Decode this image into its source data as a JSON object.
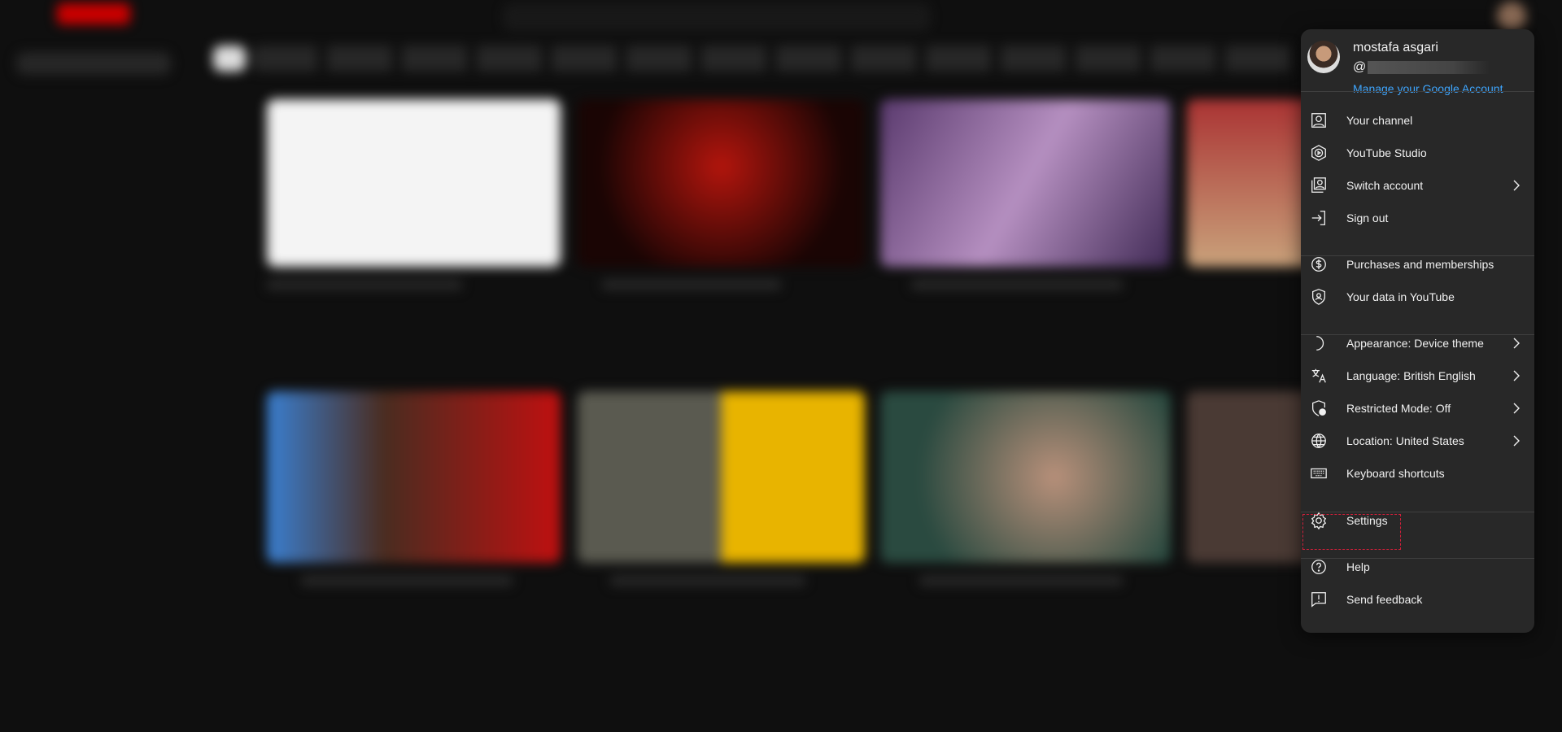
{
  "account": {
    "name": "mostafa asgari",
    "handle_prefix": "@",
    "manage_link": "Manage your Google Account"
  },
  "menu": {
    "groups": [
      [
        {
          "label": "Your channel",
          "icon": "person-icon",
          "submenu": false
        },
        {
          "label": "YouTube Studio",
          "icon": "studio-icon",
          "submenu": false
        },
        {
          "label": "Switch account",
          "icon": "switch-account-icon",
          "submenu": true
        },
        {
          "label": "Sign out",
          "icon": "sign-out-icon",
          "submenu": false
        }
      ],
      [
        {
          "label": "Purchases and memberships",
          "icon": "dollar-icon",
          "submenu": false
        },
        {
          "label": "Your data in YouTube",
          "icon": "shield-person-icon",
          "submenu": false
        }
      ],
      [
        {
          "label": "Appearance: Device theme",
          "icon": "moon-icon",
          "submenu": true
        },
        {
          "label": "Language: British English",
          "icon": "translate-icon",
          "submenu": true
        },
        {
          "label": "Restricted Mode: Off",
          "icon": "restricted-shield-icon",
          "submenu": true
        },
        {
          "label": "Location: United States",
          "icon": "globe-icon",
          "submenu": true
        },
        {
          "label": "Keyboard shortcuts",
          "icon": "keyboard-icon",
          "submenu": false
        }
      ],
      [
        {
          "label": "Settings",
          "icon": "gear-icon",
          "submenu": false,
          "highlighted": true
        }
      ],
      [
        {
          "label": "Help",
          "icon": "help-icon",
          "submenu": false
        },
        {
          "label": "Send feedback",
          "icon": "feedback-icon",
          "submenu": false
        }
      ]
    ]
  },
  "colors": {
    "link": "#3ea6ff",
    "menu_bg": "#282828",
    "highlight": "#d0203a"
  }
}
